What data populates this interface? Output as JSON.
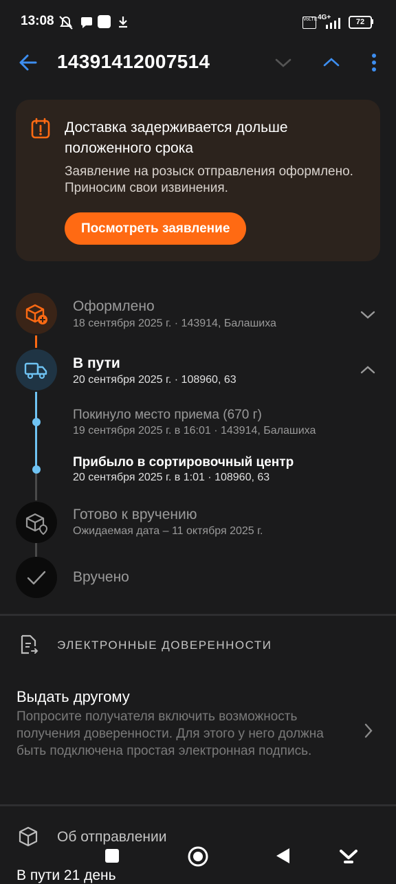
{
  "status_bar": {
    "time": "13:08",
    "network": "4G+",
    "volte": "VoLTE",
    "battery": "72"
  },
  "app_bar": {
    "tracking_number": "14391412007514"
  },
  "alert": {
    "title": "Доставка задерживается дольше положенного срока",
    "text": "Заявление на розыск отправления оформлено. Приносим свои извинения.",
    "button": "Посмотреть заявление",
    "accent": "#ff6a13"
  },
  "timeline": {
    "steps": [
      {
        "title": "Оформлено",
        "subtitle": "18 сентября 2025 г. · 143914, Балашиха"
      },
      {
        "title": "В пути",
        "subtitle": "20 сентября 2025 г. · 108960, 63"
      },
      {
        "title": "Готово к вручению",
        "subtitle": "Ожидаемая дата – 11 октября 2025 г."
      },
      {
        "title": "Вручено"
      }
    ],
    "events": [
      {
        "title": "Покинуло место приема (670 г)",
        "subtitle": "19 сентября 2025 г. в 16:01 · 143914, Балашиха"
      },
      {
        "title": "Прибыло в сортировочный центр",
        "subtitle": "20 сентября 2025 г. в 1:01 · 108960, 63"
      }
    ]
  },
  "proxies": {
    "header": "ЭЛЕКТРОННЫЕ ДОВЕРЕННОСТИ",
    "title": "Выдать другому",
    "text": "Попросите получателя включить возможность получения доверенности. Для этого у него должна быть подключена простая электронная подпись."
  },
  "about": {
    "header": "Об отправлении",
    "partial_text": "В пути 21 день"
  },
  "colors": {
    "background": "#1b1b1c",
    "link_blue": "#3d8ef0",
    "timeline_blue": "#6fc3f3"
  }
}
